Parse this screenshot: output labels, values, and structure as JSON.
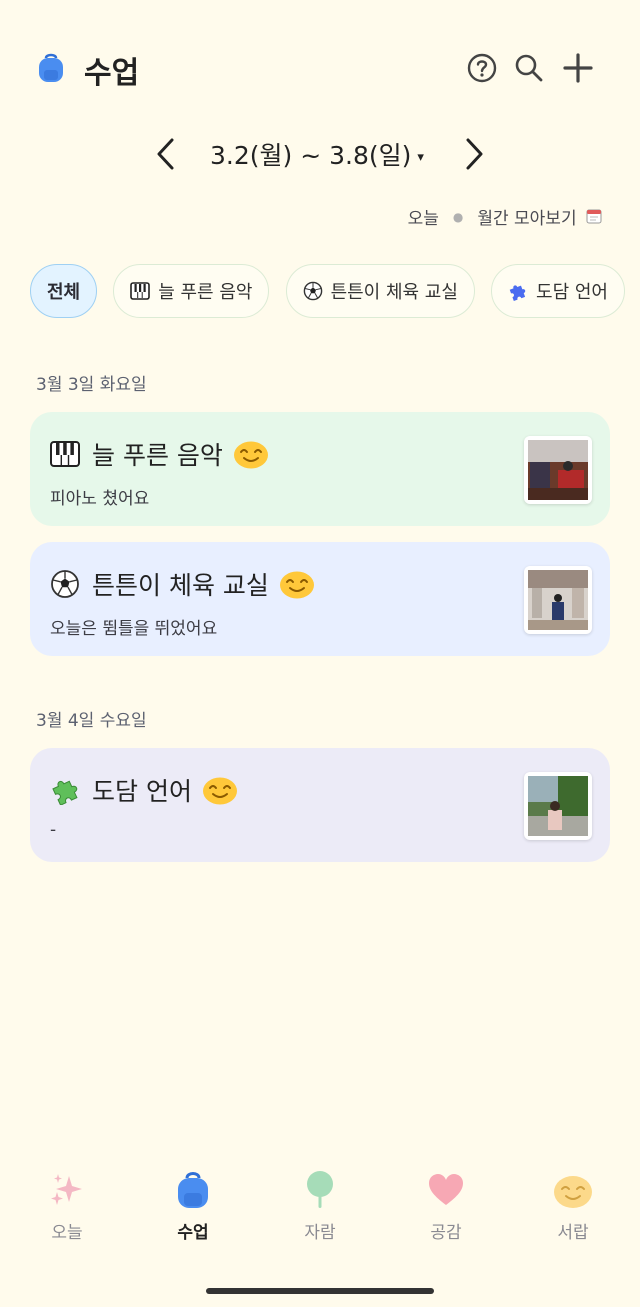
{
  "header": {
    "title": "수업",
    "icons": [
      "backpack-icon",
      "help-icon",
      "search-icon",
      "plus-icon"
    ]
  },
  "week_nav": {
    "range": "3.2(월) ~ 3.8(일)",
    "caret": "▾"
  },
  "subnav": {
    "today": "오늘",
    "monthly": "월간 모아보기"
  },
  "chips": [
    {
      "label": "전체",
      "icon": "",
      "active": true
    },
    {
      "label": "늘 푸른 음악",
      "icon": "piano-icon",
      "active": false
    },
    {
      "label": "튼튼이 체육 교실",
      "icon": "soccer-ball-icon",
      "active": false
    },
    {
      "label": "도담 언어",
      "icon": "puzzle-icon",
      "active": false
    }
  ],
  "sections": [
    {
      "date": "3월 3일 화요일",
      "cards": [
        {
          "title": "늘 푸른 음악",
          "icon": "piano-icon",
          "mood": "smile-icon",
          "desc": "피아노 쳤어요",
          "bg": "#e6f8ea"
        },
        {
          "title": "튼튼이 체육 교실",
          "icon": "soccer-ball-icon",
          "mood": "smile-icon",
          "desc": "오늘은 뜀틀을 뛰었어요",
          "bg": "#e8efff"
        }
      ]
    },
    {
      "date": "3월 4일 수요일",
      "cards": [
        {
          "title": "도담 언어",
          "icon": "puzzle-icon",
          "mood": "smile-icon",
          "desc": "-",
          "bg": "#ecebf7"
        }
      ]
    }
  ],
  "bottom_nav": [
    {
      "label": "오늘",
      "icon": "sparkle-icon",
      "active": false
    },
    {
      "label": "수업",
      "icon": "backpack-icon",
      "active": true
    },
    {
      "label": "자람",
      "icon": "tree-icon",
      "active": false
    },
    {
      "label": "공감",
      "icon": "heart-icon",
      "active": false
    },
    {
      "label": "서랍",
      "icon": "smile-face-icon",
      "active": false
    }
  ],
  "colors": {
    "background": "#fffbec",
    "accent_blue": "#3b82f6",
    "chip_active_bg": "#e3f3ff"
  }
}
